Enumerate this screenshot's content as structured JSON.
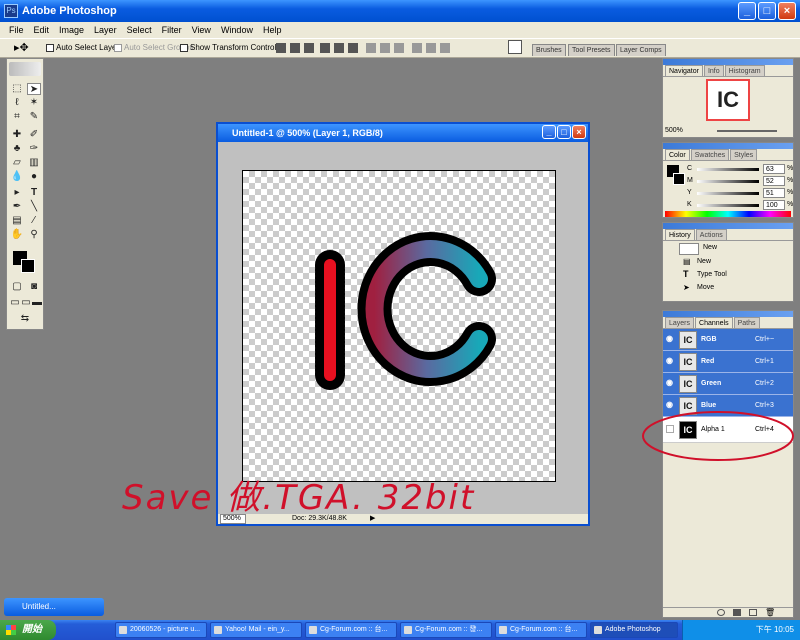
{
  "window": {
    "title": "Adobe Photoshop",
    "min": "_",
    "max": "□",
    "close": "×"
  },
  "menu": [
    "File",
    "Edit",
    "Image",
    "Layer",
    "Select",
    "Filter",
    "View",
    "Window",
    "Help"
  ],
  "options": {
    "auto_select_layer": "Auto Select Layer",
    "auto_select_groups": "Auto Select Groups",
    "show_transform": "Show Transform Controls"
  },
  "well_tabs": [
    "Brushes",
    "Tool Presets",
    "Layer Comps"
  ],
  "document": {
    "title": "Untitled-1 @ 500% (Layer 1, RGB/8)",
    "zoom": "500%",
    "doc_info": "Doc: 29.3K/48.8K",
    "art_text": "IC"
  },
  "navigator": {
    "tabs": [
      "Navigator",
      "Info",
      "Histogram"
    ],
    "zoom": "500%",
    "thumb_text": "IC"
  },
  "color": {
    "tabs": [
      "Color",
      "Swatches",
      "Styles"
    ],
    "sliders": [
      {
        "label": "C",
        "value": "63"
      },
      {
        "label": "M",
        "value": "52"
      },
      {
        "label": "Y",
        "value": "51"
      },
      {
        "label": "K",
        "value": "100"
      }
    ],
    "unit": "%"
  },
  "history": {
    "tabs": [
      "History",
      "Actions"
    ],
    "snapshot": "New",
    "items": [
      "New",
      "Type Tool",
      "Move"
    ]
  },
  "channels": {
    "tabs": [
      "Layers",
      "Channels",
      "Paths"
    ],
    "rows": [
      {
        "name": "RGB",
        "shortcut": "Ctrl+~",
        "thumb": "IC"
      },
      {
        "name": "Red",
        "shortcut": "Ctrl+1",
        "thumb": "IC"
      },
      {
        "name": "Green",
        "shortcut": "Ctrl+2",
        "thumb": "IC"
      },
      {
        "name": "Blue",
        "shortcut": "Ctrl+3",
        "thumb": "IC"
      },
      {
        "name": "Alpha 1",
        "shortcut": "Ctrl+4",
        "thumb": "IC"
      }
    ]
  },
  "annotation": {
    "text": "Save 做.TGA. 32bit",
    "color": "#d0102a"
  },
  "minimized": {
    "title": "Untitled..."
  },
  "taskbar": {
    "start": "開始",
    "items": [
      "20060526 - picture u...",
      "Yahoo! Mail - ein_y...",
      "Cg-Forum.com :: 台...",
      "Cg-Forum.com :: 發...",
      "Cg-Forum.com :: 台...",
      "Adobe Photoshop"
    ],
    "clock": "下午 10:05"
  },
  "colors": {
    "titlebar": "#0a5ce0",
    "channels_selected": "#3a72d0",
    "red_stroke": "#e81020",
    "teal_stroke": "#1aa0b0"
  }
}
